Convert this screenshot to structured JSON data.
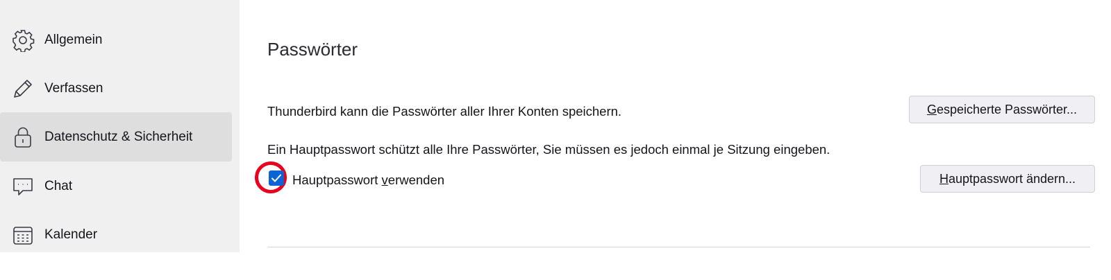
{
  "sidebar": {
    "items": [
      {
        "label": "Allgemein",
        "icon": "gear-icon",
        "selected": false
      },
      {
        "label": "Verfassen",
        "icon": "pencil-icon",
        "selected": false
      },
      {
        "label": "Datenschutz & Sicherheit",
        "icon": "lock-icon",
        "selected": true
      },
      {
        "label": "Chat",
        "icon": "chat-icon",
        "selected": false
      },
      {
        "label": "Kalender",
        "icon": "calendar-icon",
        "selected": false
      }
    ]
  },
  "passwords": {
    "title": "Passwörter",
    "saved_text": "Thunderbird kann die Passwörter aller Ihrer Konten speichern.",
    "saved_button": {
      "accesskey": "G",
      "rest": "espeicherte Passwörter..."
    },
    "master_text": "Ein Hauptpasswort schützt alle Ihre Passwörter, Sie müssen es jedoch einmal je Sitzung eingeben.",
    "checkbox": {
      "checked": true,
      "label_pre": "Hauptpasswort ",
      "label_key": "v",
      "label_post": "erwenden"
    },
    "change_button": {
      "accesskey": "H",
      "rest": "auptpasswort ändern..."
    }
  },
  "colors": {
    "accent": "#0a64d6",
    "annotation": "#e8001c"
  }
}
